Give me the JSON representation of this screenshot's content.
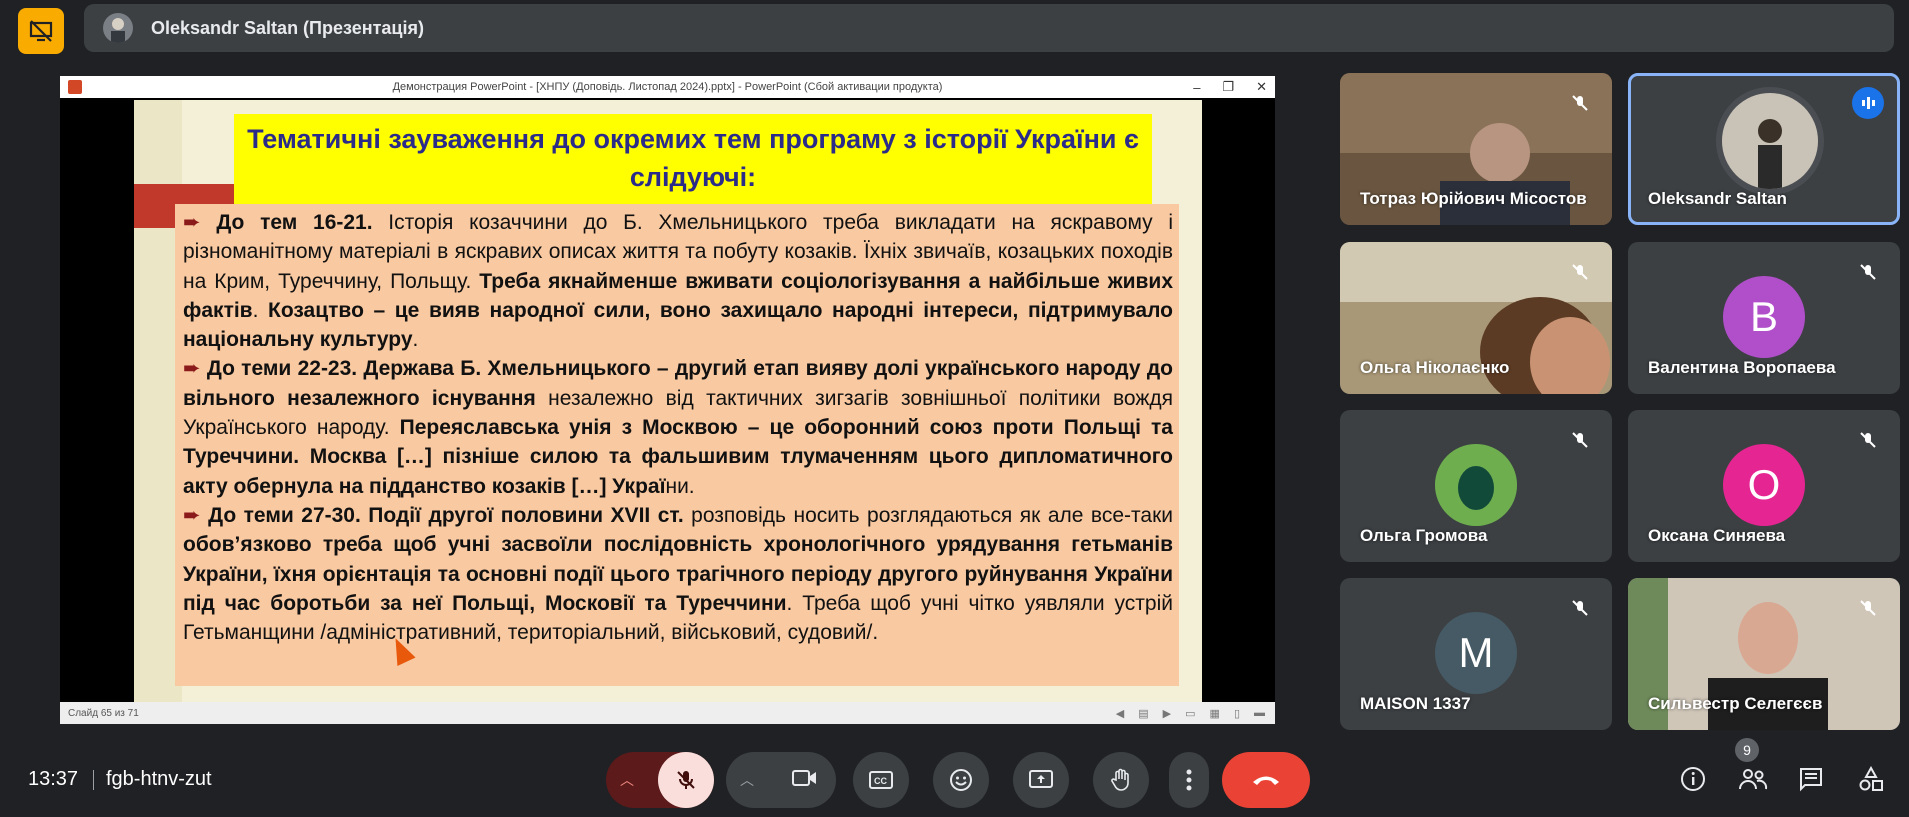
{
  "meeting": {
    "presenter_label": "Oleksandr Saltan (Презентація)",
    "time": "13:37",
    "code": "fgb-htnv-zut",
    "participants_count": "9"
  },
  "ppt": {
    "window_title": "Демонстрация PowerPoint - [ХНПУ (Доповідь. Листопад 2024).pptx] - PowerPoint (Сбой активации продукта)",
    "status": "Слайд 65 из 71",
    "slide_title": "Тематичні зауваження до окремих тем програму з історії України є слідуючі:",
    "para1_bold1": "До тем 16-21.",
    "para1_text1": " Історія козаччини до Б. Хмельницького треба викладати на яскравому і різноманітному матеріалі в яскравих описах життя та побуту козаків. Їхніх звичаїв, козацьких походів на Крим, Туреччину, Польщу. ",
    "para1_bold2": "Треба якнайменше вживати соціологізування а найбільше живих фактів",
    "para1_text2": ". ",
    "para1_bold3": "Козацтво – це вияв народної сили, воно захищало народні інтереси, підтримувало національну культуру",
    "para1_text3": ".",
    "para2_bold1": "До теми 22-23. Держава Б. Хмельницького – другий етап вияву долі українського народу до вільного незалежного існування",
    "para2_text1": " незалежно від тактичних зигзагів зовнішньої політики вождя Українського народу. ",
    "para2_bold2": "Переяславська унія з Москвою – це оборонний союз проти Польщі та Туреччини. Москва […] пізніше силою та фальшивим тлумаченням цього дипломатичного акту обернула на підданство козаків […] Украї",
    "para2_text2": "ни.",
    "para3_bold1": "До теми 27-30. Події другої половини XVII ст.",
    "para3_text1": " розповідь носить розглядаються як але все-таки ",
    "para3_bold2": "обов’язково треба щоб учні засвоїли послідовність хронологічного урядування гетьманів України, їхня орієнтація та основні події цього трагічного періоду другого руйнування України під час боротьби за неї Польщі, Московії та Туреччини",
    "para3_text2": ". Треба щоб учні чітко уявляли устрій Гетьманщини /адміністративний, територіальний, військовий, судовий/."
  },
  "participants": [
    {
      "name": "Тотраз Юрійович Місостов",
      "muted": true
    },
    {
      "name": "Oleksandr Saltan",
      "speaking": true
    },
    {
      "name": "Ольга Ніколаєнко",
      "muted": true
    },
    {
      "name": "Валентина Воропаева",
      "initial": "В",
      "color": "#b04fc9",
      "muted": true
    },
    {
      "name": "Ольга Громова",
      "muted": true
    },
    {
      "name": "Оксана Синяева",
      "initial": "О",
      "color": "#e52592",
      "muted": true
    },
    {
      "name": "MAISON 1337",
      "initial": "M",
      "color": "#455a64",
      "muted": true
    },
    {
      "name": "Сильвестр Селегєєв",
      "muted": true
    }
  ]
}
